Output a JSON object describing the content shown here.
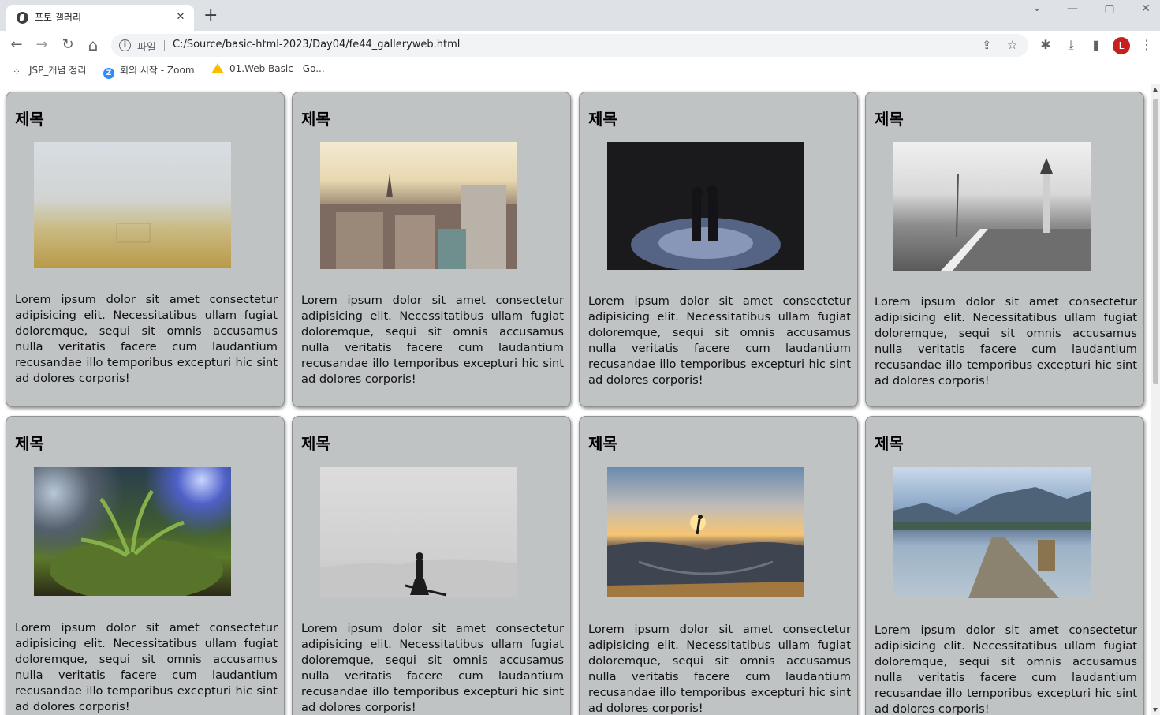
{
  "browser": {
    "tab_title": "포토 갤러리",
    "tab_close": "✕",
    "new_tab": "+",
    "url_scheme_label": "파일",
    "url": "C:/Source/basic-html-2023/Day04/fe44_galleryweb.html",
    "avatar_letter": "L",
    "icons": {
      "back": "←",
      "forward": "→",
      "reload": "↻",
      "home": "⌂",
      "share": "⇪",
      "star": "☆",
      "extensions": "✱",
      "download": "⤓",
      "sidepanel": "▮",
      "menu": "⋮",
      "minimize": "—",
      "maximize": "▢",
      "close": "✕",
      "tabsearch": "⌄",
      "info": "i"
    },
    "bookmarks": [
      {
        "label": "JSP_개념 정리",
        "icon": "apps-icon"
      },
      {
        "label": "회의 시작 - Zoom",
        "icon": "zoom-icon"
      },
      {
        "label": "01.Web Basic - Go...",
        "icon": "drive-icon"
      }
    ]
  },
  "gallery": {
    "cards": [
      {
        "title": "제목",
        "photo": "foggy-field",
        "text": "Lorem ipsum dolor sit amet consectetur adipisicing elit. Necessitatibus ullam fugiat doloremque, sequi sit omnis accusamus nulla veritatis facere cum laudantium recusandae illo temporibus excepturi hic sint ad dolores corporis!"
      },
      {
        "title": "제목",
        "photo": "city-rooftops",
        "text": "Lorem ipsum dolor sit amet consectetur adipisicing elit. Necessitatibus ullam fugiat doloremque, sequi sit omnis accusamus nulla veritatis facere cum laudantium recusandae illo temporibus excepturi hic sint ad dolores corporis!"
      },
      {
        "title": "제목",
        "photo": "night-couple",
        "text": "Lorem ipsum dolor sit amet consectetur adipisicing elit. Necessitatibus ullam fugiat doloremque, sequi sit omnis accusamus nulla veritatis facere cum laudantium recusandae illo temporibus excepturi hic sint ad dolores corporis!"
      },
      {
        "title": "제목",
        "photo": "pier-lighthouse",
        "text": "Lorem ipsum dolor sit amet consectetur adipisicing elit. Necessitatibus ullam fugiat doloremque, sequi sit omnis accusamus nulla veritatis facere cum laudantium recusandae illo temporibus excepturi hic sint ad dolores corporis!"
      },
      {
        "title": "제목",
        "photo": "moss-plant",
        "text": "Lorem ipsum dolor sit amet consectetur adipisicing elit. Necessitatibus ullam fugiat doloremque, sequi sit omnis accusamus nulla veritatis facere cum laudantium recusandae illo temporibus excepturi hic sint ad dolores corporis!"
      },
      {
        "title": "제목",
        "photo": "desert-guitarist",
        "text": "Lorem ipsum dolor sit amet consectetur adipisicing elit. Necessitatibus ullam fugiat doloremque, sequi sit omnis accusamus nulla veritatis facere cum laudantium recusandae illo temporibus excepturi hic sint ad dolores corporis!"
      },
      {
        "title": "제목",
        "photo": "skatepark-sunset",
        "text": "Lorem ipsum dolor sit amet consectetur adipisicing elit. Necessitatibus ullam fugiat doloremque, sequi sit omnis accusamus nulla veritatis facere cum laudantium recusandae illo temporibus excepturi hic sint ad dolores corporis!"
      },
      {
        "title": "제목",
        "photo": "lake-dock",
        "text": "Lorem ipsum dolor sit amet consectetur adipisicing elit. Necessitatibus ullam fugiat doloremque, sequi sit omnis accusamus nulla veritatis facere cum laudantium recusandae illo temporibus excepturi hic sint ad dolores corporis!"
      }
    ]
  },
  "colors": {
    "card_background": "#bfc3c4",
    "chrome_frame": "#dee1e6",
    "avatar": "#c5221f"
  }
}
